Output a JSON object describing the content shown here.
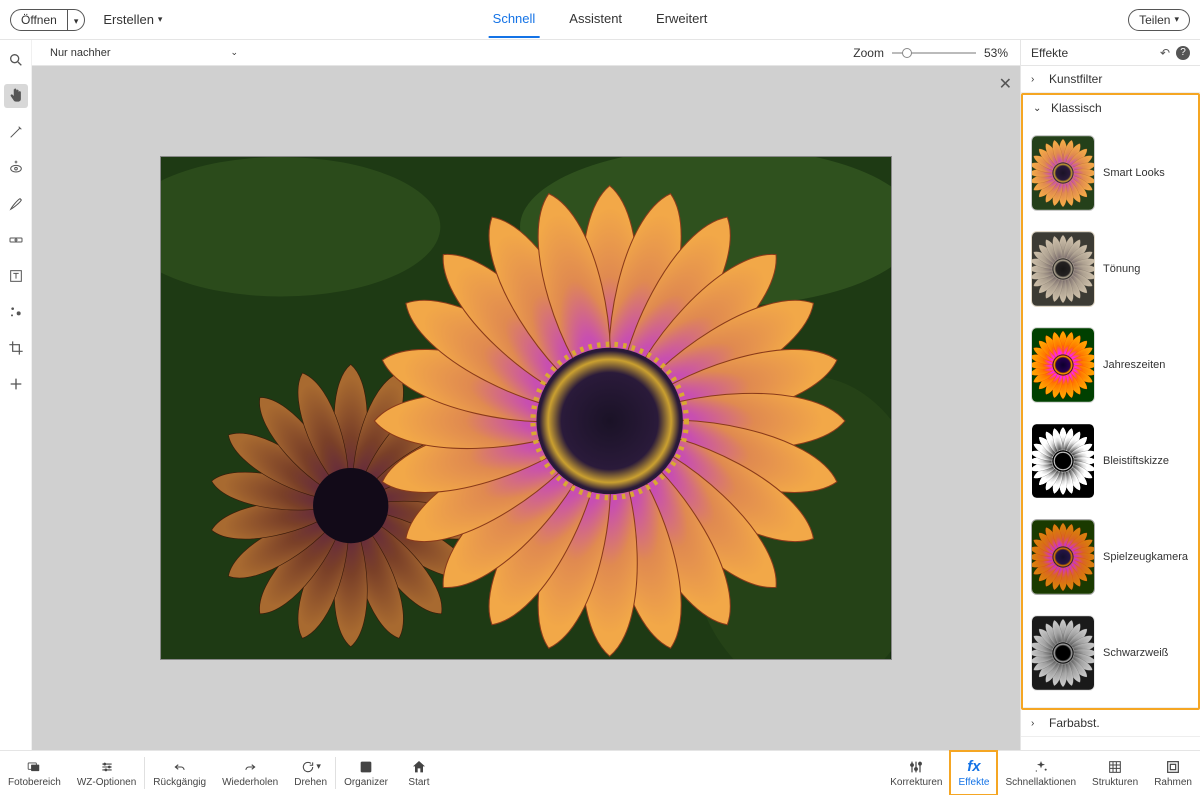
{
  "topbar": {
    "open": "Öffnen",
    "create": "Erstellen",
    "tabs": {
      "quick": "Schnell",
      "guided": "Assistent",
      "expert": "Erweitert"
    },
    "share": "Teilen"
  },
  "canvasbar": {
    "view_mode": "Nur nachher",
    "zoom_label": "Zoom",
    "zoom_value": "53%"
  },
  "tools": [
    {
      "name": "zoom-tool",
      "icon": "zoom"
    },
    {
      "name": "hand-tool",
      "icon": "hand",
      "active": true
    },
    {
      "name": "quick-select-tool",
      "icon": "wand-line"
    },
    {
      "name": "redeye-tool",
      "icon": "eye-plus"
    },
    {
      "name": "whiten-tool",
      "icon": "brush"
    },
    {
      "name": "straighten-tool",
      "icon": "level"
    },
    {
      "name": "type-tool",
      "icon": "type"
    },
    {
      "name": "spot-heal-tool",
      "icon": "sparkle"
    },
    {
      "name": "crop-tool",
      "icon": "crop"
    },
    {
      "name": "move-tool",
      "icon": "plus"
    }
  ],
  "effects": {
    "panel_title": "Effekte",
    "sections": {
      "kunstfilter": {
        "label": "Kunstfilter",
        "open": false
      },
      "klassisch": {
        "label": "Klassisch",
        "open": true,
        "items": [
          {
            "name": "smart-looks",
            "label": "Smart Looks",
            "filter": "normal"
          },
          {
            "name": "toenung",
            "label": "Tönung",
            "filter": "sepia-gray"
          },
          {
            "name": "jahreszeiten",
            "label": "Jahreszeiten",
            "filter": "vivid"
          },
          {
            "name": "bleistiftskizze",
            "label": "Bleistiftskizze",
            "filter": "sketch"
          },
          {
            "name": "spielzeugkamera",
            "label": "Spielzeugkamera",
            "filter": "toy"
          },
          {
            "name": "schwarzweiss",
            "label": "Schwarzweiß",
            "filter": "bw"
          }
        ]
      },
      "farbabst": {
        "label": "Farbabst.",
        "open": false
      }
    }
  },
  "bottombar": {
    "left": [
      {
        "name": "fotobereich",
        "label": "Fotobereich",
        "icon": "photos"
      },
      {
        "name": "wz-optionen",
        "label": "WZ-Optionen",
        "icon": "options"
      }
    ],
    "mid": [
      {
        "name": "rueckgaengig",
        "label": "Rückgängig",
        "icon": "undo"
      },
      {
        "name": "wiederholen",
        "label": "Wiederholen",
        "icon": "redo"
      },
      {
        "name": "drehen",
        "label": "Drehen",
        "icon": "rotate"
      }
    ],
    "mid2": [
      {
        "name": "organizer",
        "label": "Organizer",
        "icon": "organizer"
      },
      {
        "name": "start",
        "label": "Start",
        "icon": "home"
      }
    ],
    "right": [
      {
        "name": "korrekturen",
        "label": "Korrekturen",
        "icon": "sliders"
      },
      {
        "name": "effekte",
        "label": "Effekte",
        "icon": "fx",
        "active": true,
        "highlight": true
      },
      {
        "name": "schnellaktionen",
        "label": "Schnellaktionen",
        "icon": "sparkles"
      },
      {
        "name": "strukturen",
        "label": "Strukturen",
        "icon": "texture"
      },
      {
        "name": "rahmen",
        "label": "Rahmen",
        "icon": "frame"
      }
    ]
  }
}
